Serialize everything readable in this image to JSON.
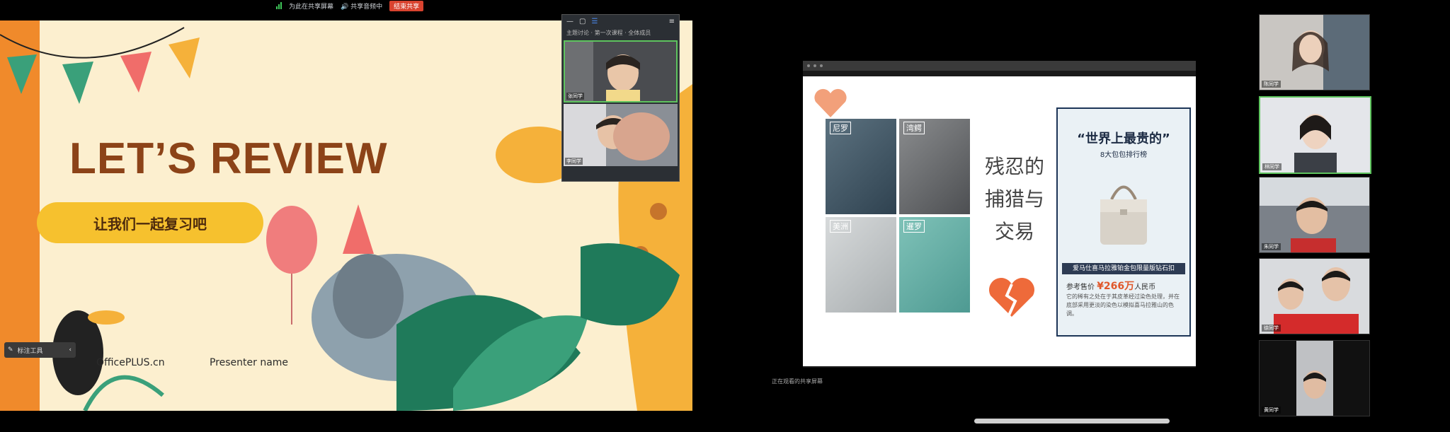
{
  "status_bar": {
    "recording_text": "为此在共享屏幕",
    "audio_text": "共享音频中",
    "end_button": "结束共享"
  },
  "left_slide": {
    "title": "LET’S REVIEW",
    "subtitle_pill": "让我们一起复习吧",
    "brand": "OfficePLUS.cn",
    "presenter": "Presenter name",
    "annotation_toggle": "标注工具"
  },
  "video_panel": {
    "topic": "主题讨论 · 第一次课程 · 全体成员",
    "tiles": [
      {
        "label": "张同学"
      },
      {
        "label": "李同学"
      }
    ]
  },
  "right_slide": {
    "leather_tags": [
      "尼罗",
      "湾鳄",
      "美洲",
      "暹罗"
    ],
    "middle_text": [
      "残忍的",
      "捕猎与",
      "交易"
    ],
    "card": {
      "title": "“世界上最贵的”",
      "subtitle": "8大包包排行榜",
      "band": "爱马仕喜马拉雅铂金包限量版钻石扣",
      "price_prefix": "参考售价 ",
      "price_value": "¥266万",
      "price_suffix": "人民币",
      "description": "它的稀有之处在于其皮革经过染色处理，并在底部采用更淡的染色以模拟喜马拉雅山的色调。"
    }
  },
  "right_caption": "正在观看的共享屏幕",
  "participants": [
    {
      "label": "陈同学"
    },
    {
      "label": "林同学"
    },
    {
      "label": "朱同学"
    },
    {
      "label": "徐同学"
    },
    {
      "label": "黄同学"
    }
  ]
}
